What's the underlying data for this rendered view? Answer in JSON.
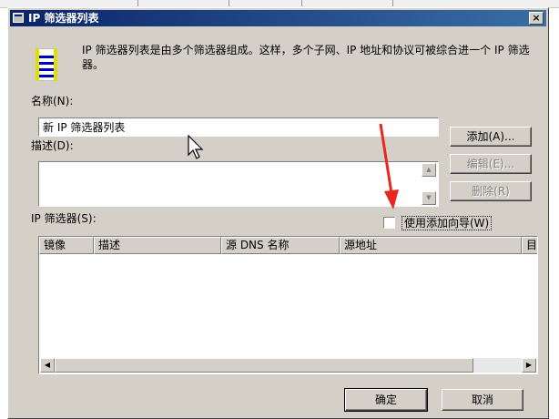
{
  "dialog": {
    "title": "IP 筛选器列表",
    "close_glyph": "×",
    "description": "IP 筛选器列表是由多个筛选器组成。这样，多个子网、IP 地址和协议可被综合进一个 IP 筛选器。"
  },
  "name": {
    "label": "名称(N):",
    "value": "新 IP 筛选器列表"
  },
  "desc": {
    "label": "描述(D):",
    "value": ""
  },
  "buttons": {
    "add": "添加(A)...",
    "edit": "编辑(E)...",
    "remove": "删除(R)",
    "ok": "确定",
    "cancel": "取消"
  },
  "filters": {
    "label": "IP 筛选器(S):",
    "use_wizard": "使用添加向导(W)",
    "use_wizard_checked": false,
    "columns": [
      "镜像",
      "描述",
      "源 DNS 名称",
      "源地址",
      "目"
    ],
    "rows": []
  },
  "icons": {
    "title": "window-icon",
    "filter": "filter-list-icon",
    "scroll_up": "▲",
    "scroll_down": "▼",
    "scroll_left": "◀",
    "scroll_right": "▶"
  },
  "colors": {
    "title_bar_start": "#0a246a",
    "title_bar_end": "#3a6ea5",
    "dialog_face": "#d4d0c8",
    "annotation_arrow": "#e8271e"
  }
}
